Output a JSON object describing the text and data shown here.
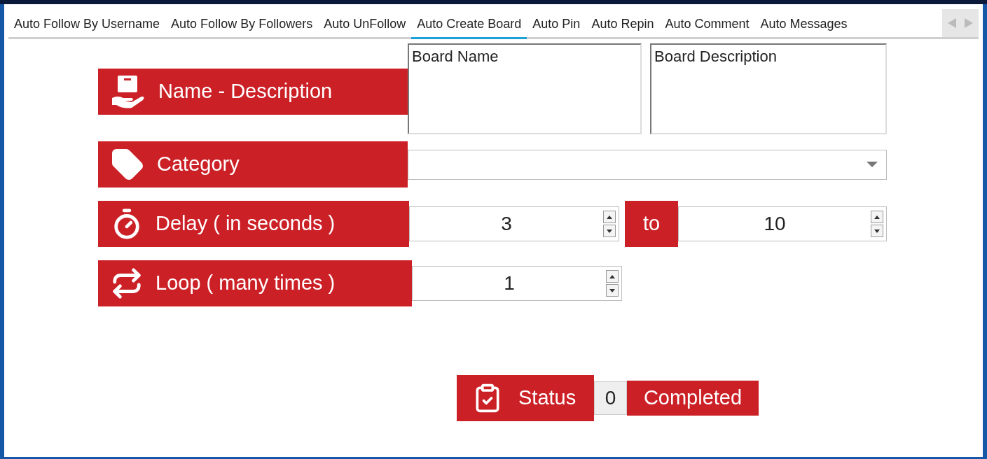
{
  "tabs": [
    {
      "label": "Auto Follow By Username",
      "selected": false
    },
    {
      "label": "Auto Follow By Followers",
      "selected": false
    },
    {
      "label": "Auto UnFollow",
      "selected": false
    },
    {
      "label": "Auto Create Board",
      "selected": true
    },
    {
      "label": "Auto Pin",
      "selected": false
    },
    {
      "label": "Auto Repin",
      "selected": false
    },
    {
      "label": "Auto Comment",
      "selected": false
    },
    {
      "label": "Auto Messages",
      "selected": false
    }
  ],
  "name_description": {
    "label": "Name - Description",
    "board_name": "Board Name",
    "board_description": "Board Description"
  },
  "category": {
    "label": "Category"
  },
  "delay": {
    "label": "Delay ( in seconds )",
    "from": "3",
    "to_label": "to",
    "to": "10"
  },
  "loop": {
    "label": "Loop ( many times )",
    "value": "1"
  },
  "status": {
    "label": "Status",
    "count": "0",
    "suffix": "Completed"
  }
}
